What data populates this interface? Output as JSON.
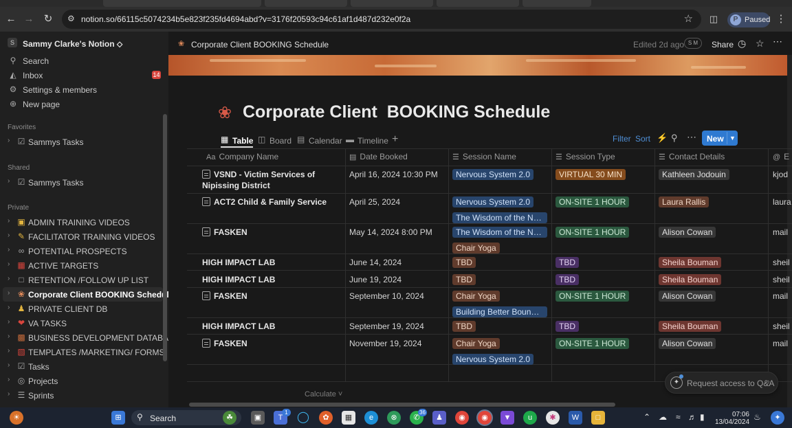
{
  "browser": {
    "url": "notion.so/66115c5074234b5e823f235fd4694abd?v=3176f20593c94c61af1d487d232e0f2a",
    "profile_initial": "P",
    "profile_label": "Paused"
  },
  "sidebar": {
    "workspace_initial": "S",
    "workspace_name": "Sammy Clarke's Notion ⬦",
    "top_items": [
      {
        "label": "Search",
        "icon": "search-icon"
      },
      {
        "label": "Inbox",
        "icon": "inbox-icon",
        "badge": "14"
      },
      {
        "label": "Settings & members",
        "icon": "gear-icon"
      },
      {
        "label": "New page",
        "icon": "plus-circle-icon"
      }
    ],
    "favorites_header": "Favorites",
    "favorites": [
      {
        "label": "Sammys Tasks"
      }
    ],
    "shared_header": "Shared",
    "shared": [
      {
        "label": "Sammys Tasks"
      }
    ],
    "private_header": "Private",
    "private": [
      {
        "label": "ADMIN TRAINING VIDEOS",
        "icon": "notebook-icon",
        "color": "#e2b43f"
      },
      {
        "label": "FACILITATOR TRAINING VIDEOS",
        "icon": "memo-icon",
        "color": "#e2b43f"
      },
      {
        "label": "POTENTIAL PROSPECTS",
        "icon": "paperclip-icon",
        "color": "#b0b0b0"
      },
      {
        "label": "ACTIVE TARGETS",
        "icon": "chart-icon",
        "color": "#d9453d"
      },
      {
        "label": "RETENTION /FOLLOW UP LIST",
        "icon": "page-icon",
        "color": "#a8a8a8"
      },
      {
        "label": "Corporate Client BOOKING Schedule",
        "icon": "flower-icon",
        "color": "#e08a5a"
      },
      {
        "label": "PRIVATE CLIENT DB",
        "icon": "person-icon",
        "color": "#e2b43f"
      },
      {
        "label": "VA TASKS",
        "icon": "heart-icon",
        "color": "#d9453d"
      },
      {
        "label": "BUSINESS DEVELOPMENT DATABASE",
        "icon": "briefcase-icon",
        "color": "#c46a3a"
      },
      {
        "label": "TEMPLATES /MARKETING/ FORMS",
        "icon": "book-icon",
        "color": "#d9453d"
      },
      {
        "label": "Tasks",
        "icon": "checkbox-icon",
        "color": "#c9c9c9"
      },
      {
        "label": "Projects",
        "icon": "target-icon",
        "color": "#c9c9c9"
      },
      {
        "label": "Sprints",
        "icon": "list-icon",
        "color": "#c9c9c9"
      }
    ]
  },
  "topbar": {
    "breadcrumb": "Corporate Client BOOKING Schedule",
    "edited": "Edited 2d ago",
    "avatar": "S M",
    "share": "Share"
  },
  "page": {
    "title": "Corporate Client  BOOKING Schedule",
    "views": [
      {
        "label": "Table",
        "icon": "table-icon",
        "active": true
      },
      {
        "label": "Board",
        "icon": "board-icon",
        "active": false
      },
      {
        "label": "Calendar",
        "icon": "calendar-icon",
        "active": false
      },
      {
        "label": "Timeline",
        "icon": "timeline-icon",
        "active": false
      }
    ],
    "filter": "Filter",
    "sort": "Sort",
    "new_label": "New",
    "calculate": "Calculate ˅",
    "qa_label": "Request access to Q&A"
  },
  "table": {
    "columns": [
      "Company Name",
      "Date Booked",
      "Session Name",
      "Session Type",
      "Contact Details",
      "E"
    ],
    "column_icons": [
      "Aa",
      "▤",
      "☰",
      "☰",
      "☰",
      "@"
    ],
    "rows": [
      {
        "company": "VSND - Victim Services of Nipissing District",
        "page": true,
        "date": "April 16, 2024 10:30 PM",
        "sessions": [
          {
            "t": "Nervous System 2.0",
            "c": "blue"
          }
        ],
        "type": {
          "t": "VIRTUAL 30 MIN",
          "c": "orange"
        },
        "contact": {
          "t": "Kathleen Jodouin",
          "c": "gray"
        },
        "email": "kjod"
      },
      {
        "company": "ACT2 Child & Family Service",
        "page": true,
        "date": "April 25, 2024",
        "sessions": [
          {
            "t": "Nervous System 2.0",
            "c": "blue"
          },
          {
            "t": "The Wisdom of the Nervo...",
            "c": "blue"
          }
        ],
        "type": {
          "t": "ON-SITE 1 HOUR",
          "c": "green"
        },
        "contact": {
          "t": "Laura Rallis",
          "c": "brown"
        },
        "email": "laura"
      },
      {
        "company": "FASKEN",
        "page": true,
        "date": "May 14, 2024 8:00 PM",
        "sessions": [
          {
            "t": "The Wisdom of the Nervo...",
            "c": "blue"
          },
          {
            "t": "Chair Yoga",
            "c": "brown"
          }
        ],
        "type": {
          "t": "ON-SITE 1 HOUR",
          "c": "green"
        },
        "contact": {
          "t": "Alison Cowan",
          "c": "gray"
        },
        "email": "mail"
      },
      {
        "company": "HIGH IMPACT LAB",
        "page": false,
        "date": "June 14, 2024",
        "sessions": [
          {
            "t": "TBD",
            "c": "brown"
          }
        ],
        "type": {
          "t": "TBD",
          "c": "purple"
        },
        "contact": {
          "t": "Sheila Bouman",
          "c": "red"
        },
        "email": "sheil"
      },
      {
        "company": "HIGH IMPACT LAB",
        "page": false,
        "date": "June 19, 2024",
        "sessions": [
          {
            "t": "TBD",
            "c": "brown"
          }
        ],
        "type": {
          "t": "TBD",
          "c": "purple"
        },
        "contact": {
          "t": "Sheila Bouman",
          "c": "red"
        },
        "email": "sheil"
      },
      {
        "company": "FASKEN",
        "page": true,
        "date": "September 10, 2024",
        "sessions": [
          {
            "t": "Chair Yoga",
            "c": "brown"
          },
          {
            "t": "Building Better Boundaries",
            "c": "blue"
          }
        ],
        "type": {
          "t": "ON-SITE 1 HOUR",
          "c": "green"
        },
        "contact": {
          "t": "Alison Cowan",
          "c": "gray"
        },
        "email": "mail"
      },
      {
        "company": "HIGH IMPACT LAB",
        "page": false,
        "date": "September 19, 2024",
        "sessions": [
          {
            "t": "TBD",
            "c": "brown"
          }
        ],
        "type": {
          "t": "TBD",
          "c": "purple"
        },
        "contact": {
          "t": "Sheila Bouman",
          "c": "red"
        },
        "email": "sheil"
      },
      {
        "company": "FASKEN",
        "page": true,
        "date": "November 19, 2024",
        "sessions": [
          {
            "t": "Chair Yoga",
            "c": "brown"
          },
          {
            "t": "Nervous System 2.0",
            "c": "blue"
          }
        ],
        "type": {
          "t": "ON-SITE 1 HOUR",
          "c": "green"
        },
        "contact": {
          "t": "Alison Cowan",
          "c": "gray"
        },
        "email": "mail"
      }
    ]
  },
  "taskbar": {
    "search": "Search",
    "time": "07:06",
    "date": "13/04/2024",
    "badge_whatsapp": "36",
    "badge_teams": "1"
  },
  "colors": {
    "accent": "#2f7ad1",
    "link": "#4f8fd6",
    "background": "#191919",
    "sidebar": "#202020"
  }
}
